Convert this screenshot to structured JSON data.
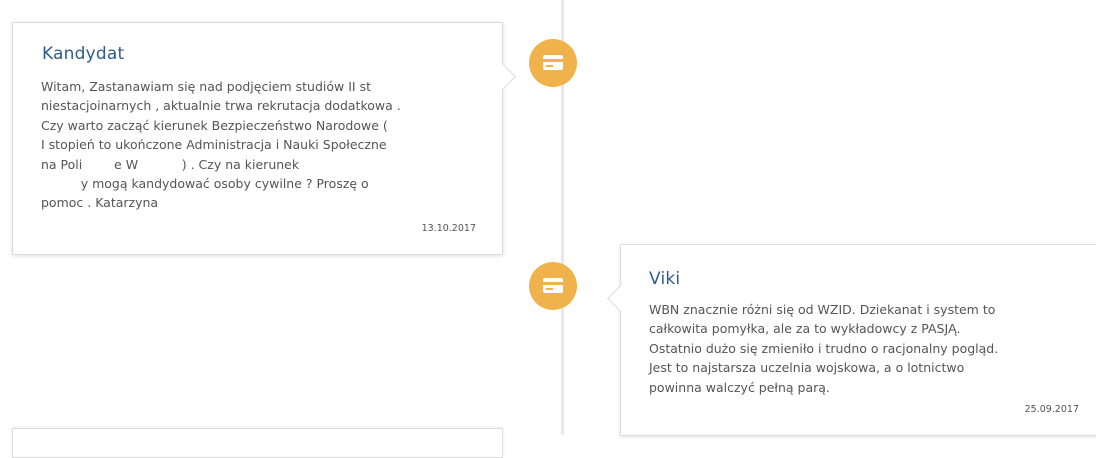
{
  "timeline": {
    "entries": [
      {
        "author": "Kandydat",
        "date": "13.10.2017",
        "icon": "credit-card-icon",
        "lines": [
          "Witam, Zastanawiam się nad podjęciem studiów II st",
          "niestacjoinarnych , aktualnie trwa rekrutacja dodatkowa .",
          "Czy warto zacząć kierunek Bezpieczeństwo Narodowe (",
          "I stopień to ukończone Administracja i Nauki Społeczne",
          "na Poli        e W           ) . Czy na kierunek",
          "          y mogą kandydować osoby cywilne ? Proszę o",
          "pomoc . Katarzyna"
        ]
      },
      {
        "author": "Viki",
        "date": "25.09.2017",
        "icon": "credit-card-icon",
        "lines": [
          "WBN znacznie różni się od WZID. Dziekanat i system to",
          "całkowita pomyłka, ale za to wykładowcy z PASJĄ.",
          "Ostatnio dużo się zmieniło i trudno o racjonalny pogląd.",
          "Jest to najstarsza uczelnia wojskowa, a o lotnictwo",
          "powinna walczyć pełną parą."
        ]
      }
    ]
  },
  "colors": {
    "accent": "#f0b24a",
    "title": "#2f5d8a",
    "text": "#555555"
  }
}
